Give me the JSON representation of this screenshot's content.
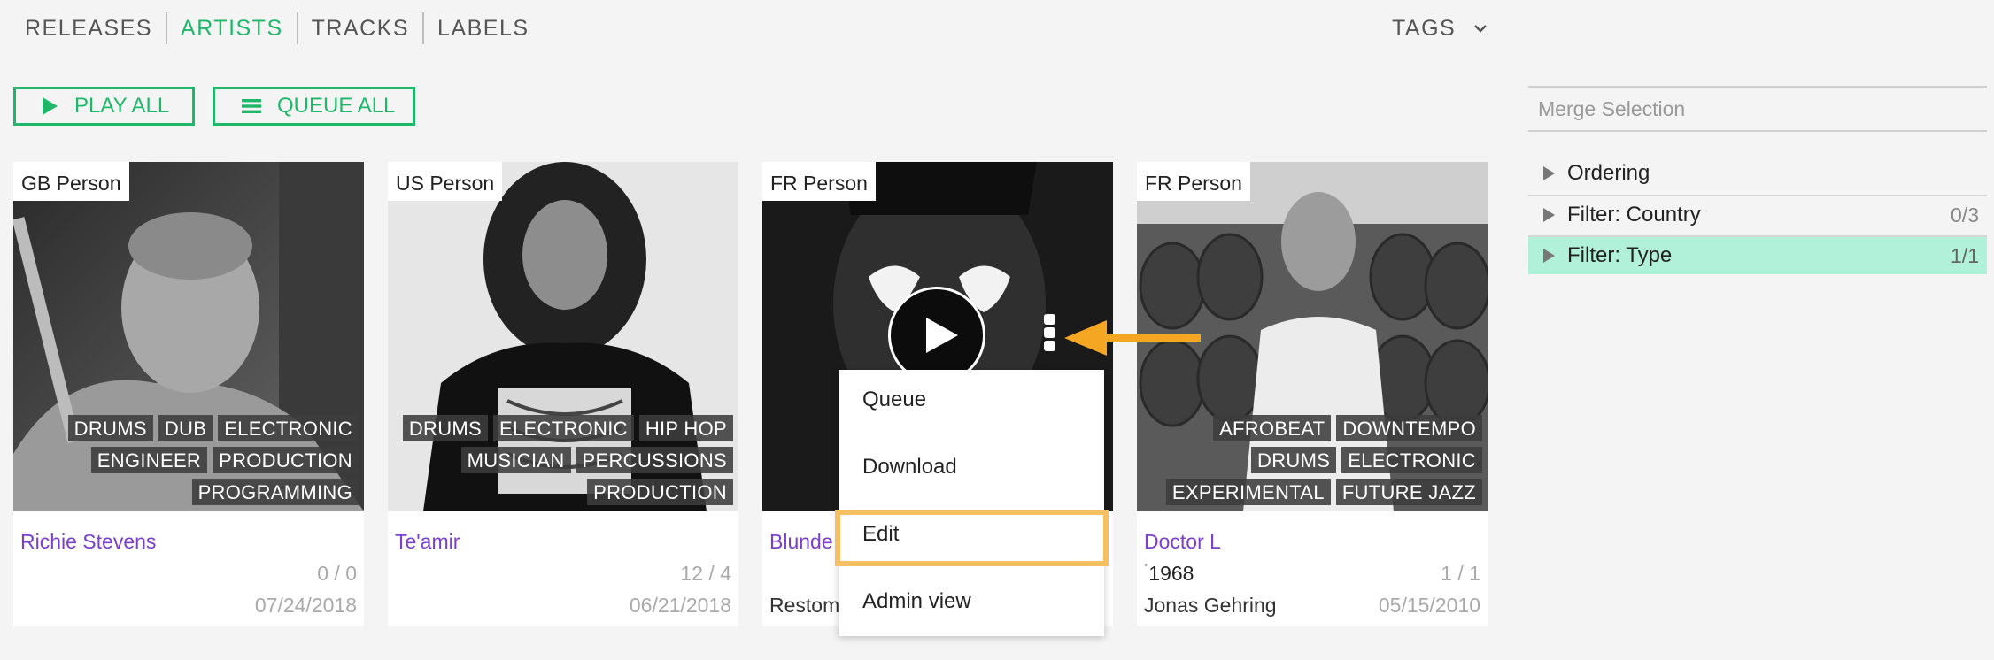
{
  "nav": {
    "items": [
      {
        "label": "RELEASES",
        "active": false
      },
      {
        "label": "ARTISTS",
        "active": true
      },
      {
        "label": "TRACKS",
        "active": false
      },
      {
        "label": "LABELS",
        "active": false
      }
    ],
    "tags_label": "TAGS"
  },
  "actions": {
    "play_all": "PLAY ALL",
    "queue_all": "QUEUE ALL"
  },
  "panel": {
    "merge_placeholder": "Merge Selection",
    "rows": [
      {
        "label": "Ordering",
        "count": ""
      },
      {
        "label": "Filter: Country",
        "count": "0/3"
      },
      {
        "label": "Filter: Type",
        "count": "1/1"
      }
    ]
  },
  "cards": [
    {
      "country": "GB Person",
      "tags": [
        "DRUMS",
        "DUB",
        "ELECTRONIC",
        "ENGINEER",
        "PRODUCTION",
        "PROGRAMMING"
      ],
      "name": "Richie Stevens",
      "counts": "0 / 0",
      "date": "07/24/2018"
    },
    {
      "country": "US Person",
      "tags": [
        "DRUMS",
        "ELECTRONIC",
        "HIP HOP",
        "MUSICIAN",
        "PERCUSSIONS",
        "PRODUCTION"
      ],
      "name": "Te'amir",
      "counts": "12 / 4",
      "date": "06/21/2018"
    },
    {
      "country": "FR Person",
      "name": "Blunde",
      "subname": "Restom"
    },
    {
      "country": "FR Person",
      "tags": [
        "AFROBEAT",
        "DOWNTEMPO",
        "DRUMS",
        "ELECTRONIC",
        "EXPERIMENTAL",
        "FUTURE JAZZ"
      ],
      "name": "Doctor L",
      "born_mark": "*",
      "born": "1968",
      "counts": "1 / 1",
      "subname": "Jonas Gehring",
      "date": "05/15/2010"
    }
  ],
  "context_menu": {
    "items": [
      "Queue",
      "Download",
      "Edit",
      "Admin view"
    ],
    "highlighted": "Edit"
  },
  "colors": {
    "accent": "#1fb86a",
    "link": "#7a3fd0",
    "highlight_row": "#b1f1da",
    "annotation": "#f5a623"
  }
}
